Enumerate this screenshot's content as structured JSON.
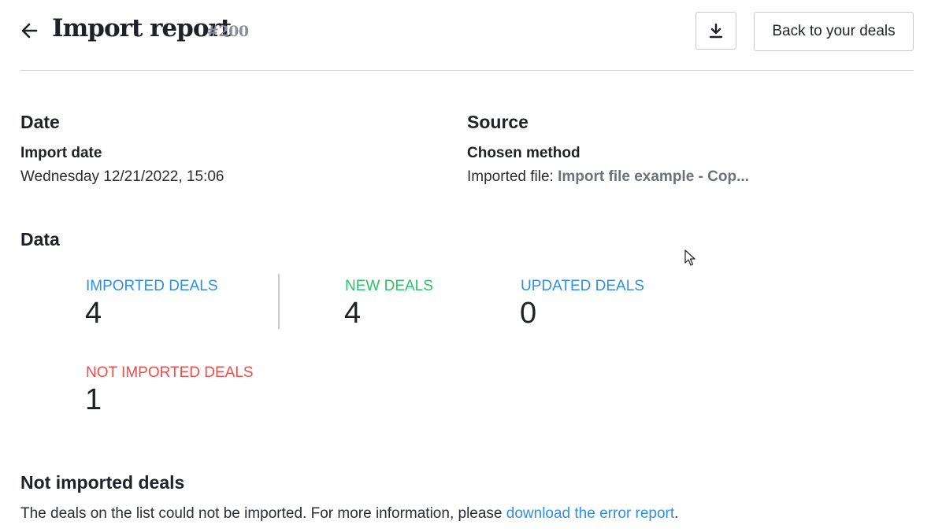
{
  "header": {
    "title": "Import report",
    "report_id": "#200",
    "back_to_deals_label": "Back to your deals"
  },
  "date_section": {
    "title": "Date",
    "label": "Import date",
    "value": "Wednesday 12/21/2022, 15:06"
  },
  "source_section": {
    "title": "Source",
    "label": "Chosen method",
    "value_prefix": "Imported file: ",
    "value_file": "Import file example - Cop..."
  },
  "data_section": {
    "title": "Data",
    "stats": [
      {
        "label": "IMPORTED DEALS",
        "value": "4",
        "color": "#2f8fe6"
      },
      {
        "label": "NEW DEALS",
        "value": "4",
        "color": "#2cc26a"
      },
      {
        "label": "UPDATED DEALS",
        "value": "0",
        "color": "#2f8fe6"
      },
      {
        "label": "NOT IMPORTED DEALS",
        "value": "1",
        "color": "#f24b4b"
      }
    ]
  },
  "not_imported_section": {
    "title": "Not imported deals",
    "text": "The deals on the list could not be imported. For more information, please ",
    "link": "download the error report",
    "text_end": "."
  },
  "icons": {
    "back": "arrow-left-icon",
    "download": "download-icon",
    "cursor": "mouse-pointer-icon"
  }
}
